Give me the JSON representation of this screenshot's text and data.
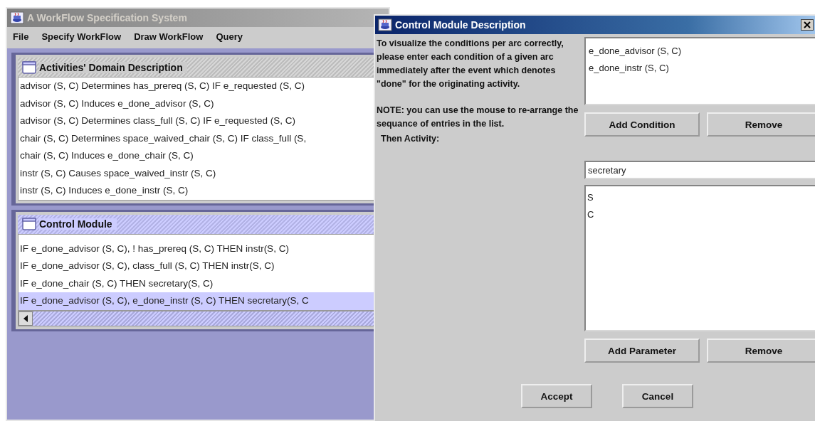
{
  "main_window": {
    "title": "A WorkFlow Specification System",
    "active": false,
    "menu": [
      "File",
      "Specify WorkFlow",
      "Draw WorkFlow",
      "Query"
    ],
    "frames": [
      {
        "title": "Activities' Domain Description",
        "active": false,
        "horizontal_scrollbar": false,
        "rows": [
          {
            "text": "advisor (S, C) Determines  has_prereq (S, C) IF  e_requested (S, C)",
            "selected": false
          },
          {
            "text": "advisor (S, C) Induces  e_done_advisor (S, C)",
            "selected": false
          },
          {
            "text": "advisor (S, C) Determines  class_full (S, C) IF  e_requested (S, C)",
            "selected": false
          },
          {
            "text": "chair (S, C) Determines  space_waived_chair (S, C) IF  class_full (S,",
            "selected": false
          },
          {
            "text": "chair (S, C) Induces  e_done_chair (S, C)",
            "selected": false
          },
          {
            "text": "instr (S, C) Causes  space_waived_instr (S, C)",
            "selected": false
          },
          {
            "text": "instr (S, C) Induces  e_done_instr (S, C)",
            "selected": false
          }
        ]
      },
      {
        "title": "Control Module",
        "active": true,
        "horizontal_scrollbar": true,
        "rows": [
          {
            "text": "IF  e_done_advisor (S, C), ! has_prereq (S, C) THEN instr(S, C)",
            "selected": false
          },
          {
            "text": "IF  e_done_advisor (S, C),  class_full (S, C) THEN instr(S, C)",
            "selected": false
          },
          {
            "text": "IF  e_done_chair (S, C) THEN secretary(S, C)",
            "selected": false
          },
          {
            "text": "IF  e_done_advisor (S, C),  e_done_instr (S, C) THEN secretary(S, C",
            "selected": true
          }
        ]
      }
    ]
  },
  "dialog": {
    "title": "Control Module Description",
    "active": true,
    "instructions": [
      "To visualize the conditions per arc correctly, please enter each condition of a given arc immediately after the event which denotes \"done\" for the originating activity.",
      "NOTE: you can use the mouse to re-arrange the sequance of entries in the list."
    ],
    "conditions": [
      "e_done_advisor (S, C)",
      "e_done_instr (S, C)"
    ],
    "condition_buttons": [
      "Add Condition",
      "Remove"
    ],
    "activity_label": "Then Activity:",
    "activity_value": "secretary",
    "parameters": [
      "S",
      "C"
    ],
    "parameter_buttons": [
      "Add Parameter",
      "Remove"
    ],
    "footer_buttons": [
      "Accept",
      "Cancel"
    ]
  }
}
